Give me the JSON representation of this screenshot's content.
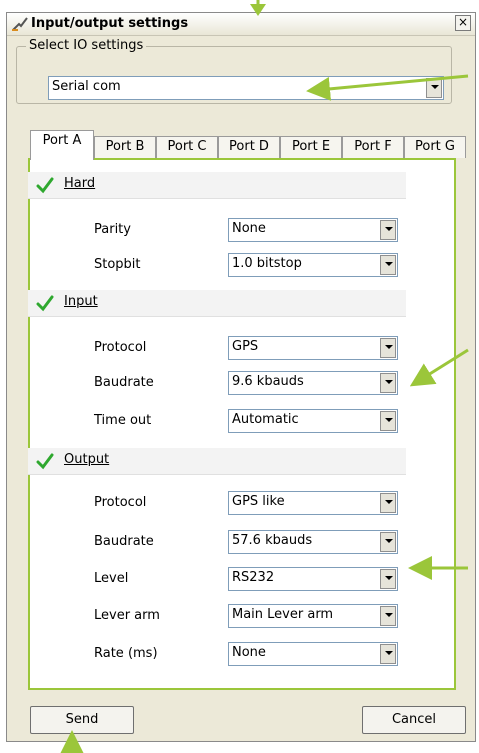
{
  "window": {
    "title": "Input/output settings",
    "close_label": "×"
  },
  "io_settings": {
    "group_label": "Select IO settings",
    "selected": "Serial com"
  },
  "tabs": [
    {
      "label": "Port A",
      "active": true
    },
    {
      "label": "Port B"
    },
    {
      "label": "Port C"
    },
    {
      "label": "Port D"
    },
    {
      "label": "Port E"
    },
    {
      "label": "Port F"
    },
    {
      "label": "Port G"
    }
  ],
  "hard": {
    "title": "Hard",
    "parity": {
      "label": "Parity",
      "value": "None"
    },
    "stopbit": {
      "label": "Stopbit",
      "value": "1.0 bitstop"
    }
  },
  "input": {
    "title": "Input",
    "protocol": {
      "label": "Protocol",
      "value": "GPS"
    },
    "baudrate": {
      "label": "Baudrate",
      "value": "9.6 kbauds"
    },
    "timeout": {
      "label": "Time out",
      "value": "Automatic"
    }
  },
  "output": {
    "title": "Output",
    "protocol": {
      "label": "Protocol",
      "value": "GPS like"
    },
    "baudrate": {
      "label": "Baudrate",
      "value": "57.6 kbauds"
    },
    "level": {
      "label": "Level",
      "value": "RS232"
    },
    "lever_arm": {
      "label": "Lever arm",
      "value": "Main Lever arm"
    },
    "rate": {
      "label": "Rate (ms)",
      "value": "None"
    }
  },
  "buttons": {
    "send": "Send",
    "cancel": "Cancel"
  },
  "colors": {
    "accent_green": "#9bc63a",
    "check_green": "#2fa82f"
  }
}
